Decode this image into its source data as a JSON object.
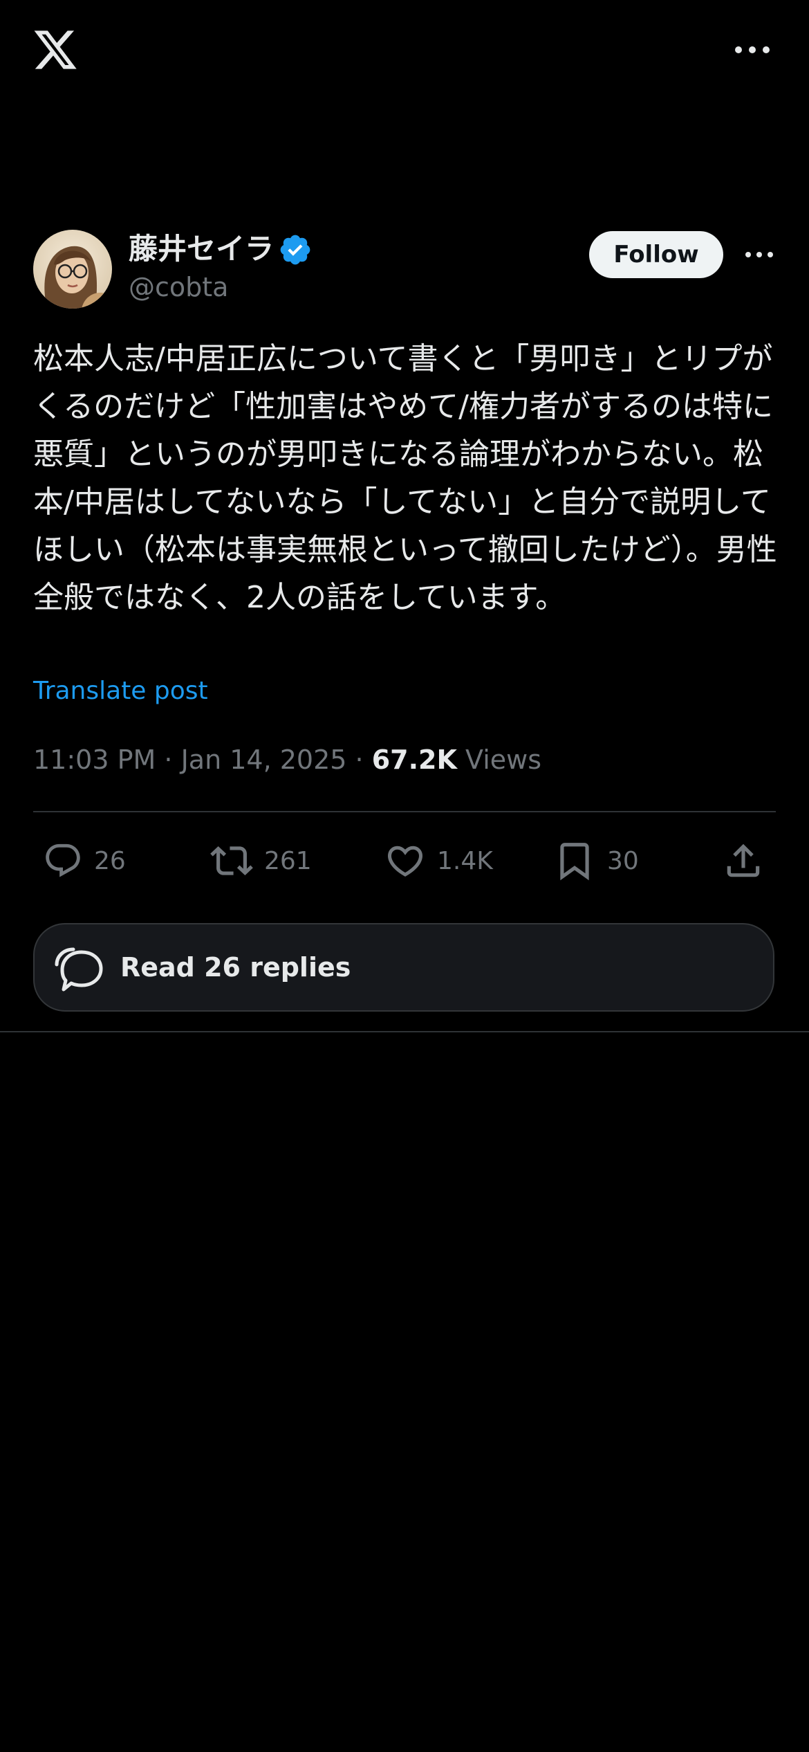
{
  "topbar": {
    "logo_icon": "x-logo-icon",
    "more_icon": "more-horizontal-icon"
  },
  "author": {
    "display_name": "藤井セイラ",
    "handle": "@cobta",
    "verified": true,
    "verified_color": "#1d9bf0",
    "avatar_icon": "avatar-photo"
  },
  "follow_label": "Follow",
  "post": {
    "text": "松本人志/中居正広について書くと「男叩き」とリプがくるのだけど「性加害はやめて/権力者がするのは特に悪質」というのが男叩きになる論理がわからない。松本/中居はしてないなら「してない」と自分で説明してほしい（松本は事実無根といって撤回したけど）。男性全般ではなく、2人の話をしています。",
    "translate_label": "Translate post",
    "time": "11:03 PM",
    "date": "Jan 14, 2025",
    "separator": "·",
    "views_count": "67.2K",
    "views_label": "Views"
  },
  "actions": {
    "replies": "26",
    "reposts": "261",
    "likes": "1.4K",
    "bookmarks": "30"
  },
  "read_replies_label": "Read 26 replies",
  "colors": {
    "background": "#000000",
    "text_primary": "#e7e9ea",
    "text_secondary": "#71767b",
    "link": "#1d9bf0",
    "border": "#2f3336"
  }
}
